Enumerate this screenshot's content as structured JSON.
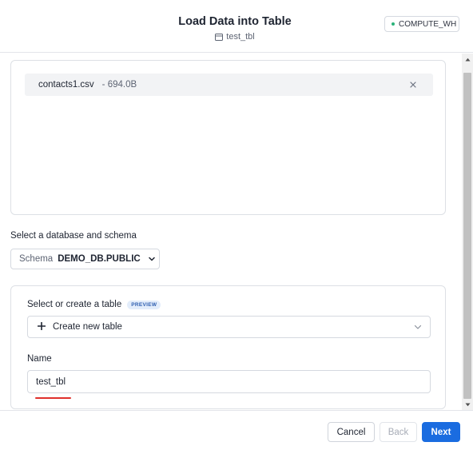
{
  "header": {
    "title": "Load Data into Table",
    "subtitle": "test_tbl",
    "warehouse": "COMPUTE_WH",
    "warehouse_status_color": "#2bb37a"
  },
  "files": [
    {
      "name": "contacts1.csv",
      "size": "- 694.0B"
    }
  ],
  "schema_section": {
    "label": "Select a database and schema",
    "prefix": "Schema",
    "value": "DEMO_DB.PUBLIC"
  },
  "table_section": {
    "label": "Select or create a table",
    "badge": "PREVIEW",
    "select_value": "Create new table",
    "name_label": "Name",
    "name_value": "test_tbl"
  },
  "footer": {
    "cancel_label": "Cancel",
    "back_label": "Back",
    "next_label": "Next"
  },
  "colors": {
    "accent": "#1a6ce0",
    "annotation_red": "#e0302c"
  }
}
